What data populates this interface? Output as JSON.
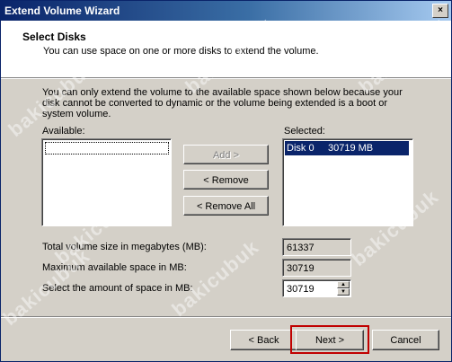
{
  "window": {
    "title": "Extend Volume Wizard",
    "close_glyph": "×"
  },
  "header": {
    "title": "Select Disks",
    "subtitle": "You can use space on one or more disks to extend the volume."
  },
  "info": "You can only extend the volume to the available space shown below because your disk cannot be converted to dynamic or the volume being extended is a boot or system volume.",
  "available": {
    "label": "Available:"
  },
  "selected": {
    "label": "Selected:",
    "items": [
      {
        "disk": "Disk 0",
        "size": "30719 MB"
      }
    ]
  },
  "buttons": {
    "add": "Add >",
    "remove": "< Remove",
    "remove_all": "< Remove All",
    "back": "< Back",
    "next": "Next >",
    "cancel": "Cancel"
  },
  "fields": {
    "total_label": "Total volume size in megabytes (MB):",
    "total_value": "61337",
    "max_label": "Maximum available space in MB:",
    "max_value": "30719",
    "amount_label": "Select the amount of space in MB:",
    "amount_value": "30719"
  },
  "spinner": {
    "up_glyph": "▲",
    "down_glyph": "▼"
  },
  "watermark": "bakicubuk",
  "highlight_color": "#c00000"
}
